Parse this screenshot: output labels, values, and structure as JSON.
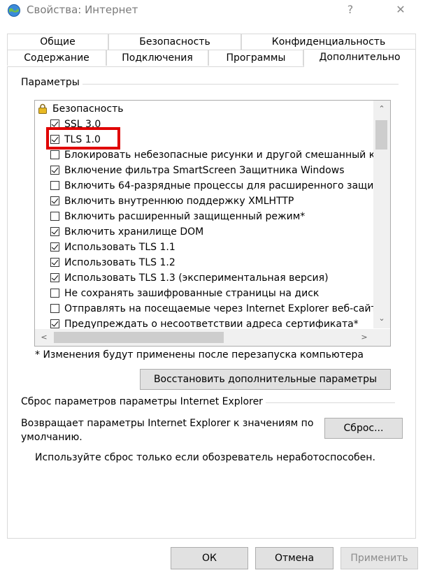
{
  "window": {
    "title": "Свойства: Интернет",
    "help_label": "?",
    "close_label": "✕"
  },
  "tabs_top": [
    "Общие",
    "Безопасность",
    "Конфиденциальность"
  ],
  "tabs_bottom": [
    "Содержание",
    "Подключения",
    "Программы",
    "Дополнительно"
  ],
  "active_tab": "Дополнительно",
  "settings": {
    "group_label": "Параметры",
    "category": "Безопасность",
    "items": [
      {
        "label": "SSL 3.0",
        "checked": true
      },
      {
        "label": "TLS 1.0",
        "checked": true
      },
      {
        "label": "Блокировать небезопасные рисунки и другой смешанный ко",
        "checked": false
      },
      {
        "label": "Включение фильтра SmartScreen Защитника Windows",
        "checked": true
      },
      {
        "label": "Включить 64-разрядные процессы для расширенного защи",
        "checked": false
      },
      {
        "label": "Включить внутреннюю поддержку XMLHTTP",
        "checked": true
      },
      {
        "label": "Включить расширенный защищенный режим*",
        "checked": false
      },
      {
        "label": "Включить хранилище DOM",
        "checked": true
      },
      {
        "label": "Использовать TLS 1.1",
        "checked": true
      },
      {
        "label": "Использовать TLS 1.2",
        "checked": true
      },
      {
        "label": "Использовать TLS 1.3 (экспериментальная версия)",
        "checked": true
      },
      {
        "label": "Не сохранять зашифрованные страницы на диск",
        "checked": false
      },
      {
        "label": "Отправлять на посещаемые через Internet Explorer веб-сайт",
        "checked": false
      },
      {
        "label": "Предупреждать о несоответствии адреса сертификата*",
        "checked": true
      }
    ],
    "restart_note": "* Изменения будут применены после перезапуска компьютера",
    "restore_button": "Восстановить дополнительные параметры"
  },
  "reset": {
    "group_label": "Сброс параметров параметры Internet Explorer",
    "description_line1": "Возвращает параметры Internet Explorer к значениям по",
    "description_line2": "умолчанию.",
    "reset_button": "Сброс...",
    "warning": "Используйте сброс только если обозреватель неработоспособен."
  },
  "footer": {
    "ok": "ОК",
    "cancel": "Отмена",
    "apply": "Применить"
  }
}
